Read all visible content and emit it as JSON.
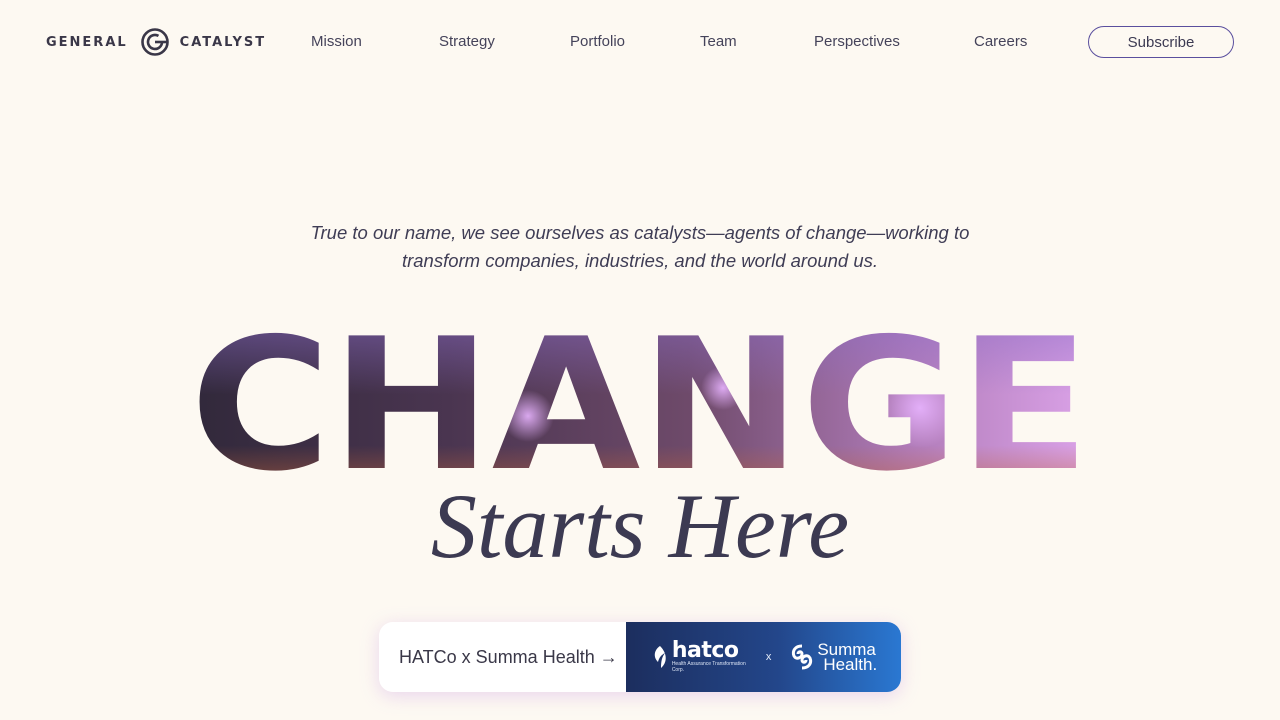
{
  "header": {
    "logo_left": "GENERAL",
    "logo_right": "CATALYST",
    "nav": [
      "Mission",
      "Strategy",
      "Portfolio",
      "Team",
      "Perspectives",
      "Careers"
    ],
    "subscribe_label": "Subscribe"
  },
  "hero": {
    "tagline": "True to our name, we see ourselves as catalysts—agents of change—working to transform companies, industries, and the world around us.",
    "headline": "CHANGE",
    "subheadline": "Starts Here"
  },
  "feature_card": {
    "label": "HATCo x Summa Health →",
    "partner_one": "hatco",
    "partner_one_sub": "Health Assurance Transformation Corp.",
    "separator": "x",
    "partner_two_line1": "Summa",
    "partner_two_line2": "Health."
  },
  "colors": {
    "background": "#FDF9F2",
    "text": "#3E3B52",
    "accent_outline": "#5A4F9E",
    "headline_gradient": [
      "#2E2738",
      "#5C3E5E",
      "#9C6E9E",
      "#E2A9F0"
    ],
    "card_gradient": [
      "#1C2E5E",
      "#2A78D2"
    ]
  },
  "icons": {
    "logo_mark": "catalyst-g-mark-icon",
    "hatco_mark": "hatco-leaf-icon",
    "summa_mark": "summa-swirl-icon"
  }
}
